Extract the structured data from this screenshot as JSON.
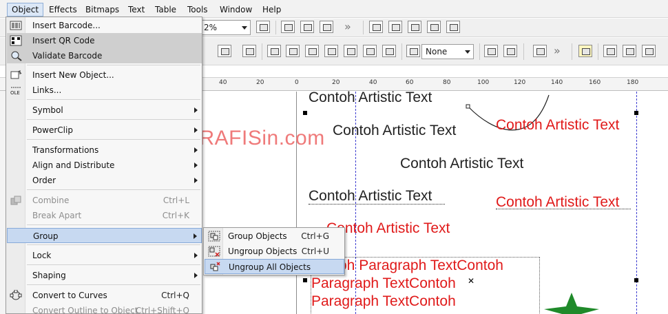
{
  "menubar": {
    "items": [
      "Object",
      "Effects",
      "Bitmaps",
      "Text",
      "Table",
      "Tools",
      "Window",
      "Help"
    ],
    "active": "Object"
  },
  "toolbar1": {
    "zoom_value": "2%"
  },
  "toolbar2": {
    "outline_value": "None"
  },
  "ruler": {
    "labels": [
      "40",
      "20",
      "0",
      "20",
      "40",
      "60",
      "80",
      "100",
      "120",
      "140",
      "160",
      "180"
    ]
  },
  "object_menu": {
    "items": [
      {
        "label": "Insert Barcode...",
        "shortcut": "",
        "state": "normal",
        "icon": "barcode-icon"
      },
      {
        "label": "Insert QR Code",
        "shortcut": "",
        "state": "highlighted",
        "icon": "qr-code-icon"
      },
      {
        "label": "Validate Barcode",
        "shortcut": "",
        "state": "highlighted",
        "icon": "validate-barcode-icon"
      },
      {
        "label": "Insert New Object...",
        "shortcut": "",
        "state": "normal",
        "icon": "insert-object-icon"
      },
      {
        "label": "Links...",
        "shortcut": "",
        "state": "normal",
        "icon": "ole-icon"
      },
      {
        "label": "Symbol",
        "shortcut": "",
        "state": "normal",
        "submenu": true
      },
      {
        "label": "PowerClip",
        "shortcut": "",
        "state": "normal",
        "submenu": true
      },
      {
        "label": "Transformations",
        "shortcut": "",
        "state": "normal",
        "submenu": true
      },
      {
        "label": "Align and Distribute",
        "shortcut": "",
        "state": "normal",
        "submenu": true
      },
      {
        "label": "Order",
        "shortcut": "",
        "state": "normal",
        "submenu": true
      },
      {
        "label": "Combine",
        "shortcut": "Ctrl+L",
        "state": "disabled",
        "icon": "combine-icon"
      },
      {
        "label": "Break Apart",
        "shortcut": "Ctrl+K",
        "state": "disabled"
      },
      {
        "label": "Group",
        "shortcut": "",
        "state": "selected",
        "submenu": true
      },
      {
        "label": "Lock",
        "shortcut": "",
        "state": "normal",
        "submenu": true
      },
      {
        "label": "Shaping",
        "shortcut": "",
        "state": "normal",
        "submenu": true
      },
      {
        "label": "Convert to Curves",
        "shortcut": "Ctrl+Q",
        "state": "normal",
        "icon": "convert-curves-icon"
      },
      {
        "label": "Convert Outline to Object",
        "shortcut": "Ctrl+Shift+Q",
        "state": "disabled"
      }
    ]
  },
  "group_submenu": {
    "items": [
      {
        "label": "Group Objects",
        "shortcut": "Ctrl+G",
        "state": "normal",
        "icon": "group-objects-icon"
      },
      {
        "label": "Ungroup Objects",
        "shortcut": "Ctrl+U",
        "state": "normal",
        "icon": "ungroup-objects-icon"
      },
      {
        "label": "Ungroup All Objects",
        "shortcut": "",
        "state": "selected",
        "icon": "ungroup-all-icon"
      }
    ]
  },
  "canvas": {
    "watermark": "www.GRAFISin.com",
    "artistic_texts": [
      {
        "text": "Contoh Artistic Text",
        "color": "#222222"
      },
      {
        "text": "Contoh Artistic Text",
        "color": "#222222"
      },
      {
        "text": "Contoh Artistic Text",
        "color": "#e01a1a"
      },
      {
        "text": "Contoh Artistic Text",
        "color": "#222222"
      },
      {
        "text": "Contoh Artistic Text",
        "color": "#222222"
      },
      {
        "text": "Contoh Artistic Text",
        "color": "#e01a1a"
      },
      {
        "text": "Contoh Artistic Text",
        "color": "#e01a1a"
      }
    ],
    "paragraph_lines": [
      "oh Paragraph TextContoh",
      "Paragraph TextContoh",
      "Paragraph TextContoh"
    ],
    "shape_color": "#1f8a2a"
  },
  "colors": {
    "menu_selected": "#c7d9f1",
    "accent_red": "#e01a1a",
    "watermark": "#ef7a7a"
  }
}
